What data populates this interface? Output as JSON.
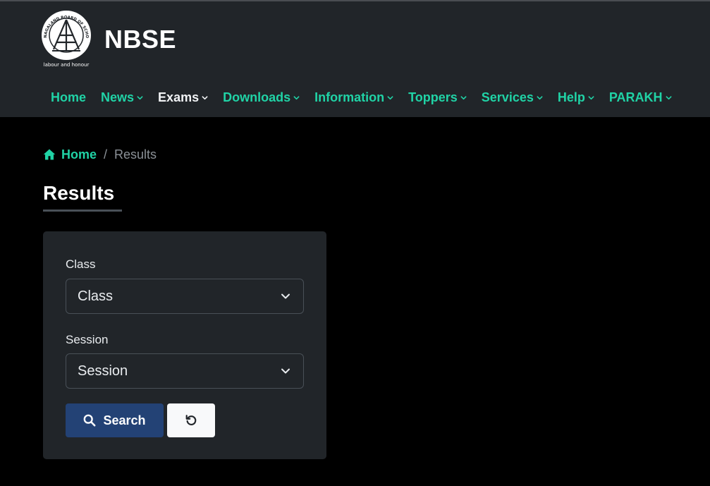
{
  "header": {
    "brand": "NBSE",
    "logo": {
      "icon": "nbse-seal-logo",
      "arc_text": "NAGALAND BOARD OF SCHOOL EDUCATION",
      "motto": "labour and honour"
    }
  },
  "nav": {
    "items": [
      {
        "label": "Home",
        "has_dropdown": false,
        "active": false
      },
      {
        "label": "News",
        "has_dropdown": true,
        "active": false
      },
      {
        "label": "Exams",
        "has_dropdown": true,
        "active": true
      },
      {
        "label": "Downloads",
        "has_dropdown": true,
        "active": false
      },
      {
        "label": "Information",
        "has_dropdown": true,
        "active": false
      },
      {
        "label": "Toppers",
        "has_dropdown": true,
        "active": false
      },
      {
        "label": "Services",
        "has_dropdown": true,
        "active": false
      },
      {
        "label": "Help",
        "has_dropdown": true,
        "active": false
      },
      {
        "label": "PARAKH",
        "has_dropdown": true,
        "active": false
      }
    ]
  },
  "breadcrumb": {
    "home_label": "Home",
    "separator": "/",
    "current": "Results"
  },
  "page": {
    "title": "Results"
  },
  "form": {
    "class_label": "Class",
    "class_value": "Class",
    "session_label": "Session",
    "session_value": "Session",
    "search_label": "Search",
    "reset_icon": "reset-icon"
  },
  "colors": {
    "accent": "#20d3a6",
    "header_bg": "#212529",
    "page_bg": "#000000",
    "search_button": "#234275"
  }
}
